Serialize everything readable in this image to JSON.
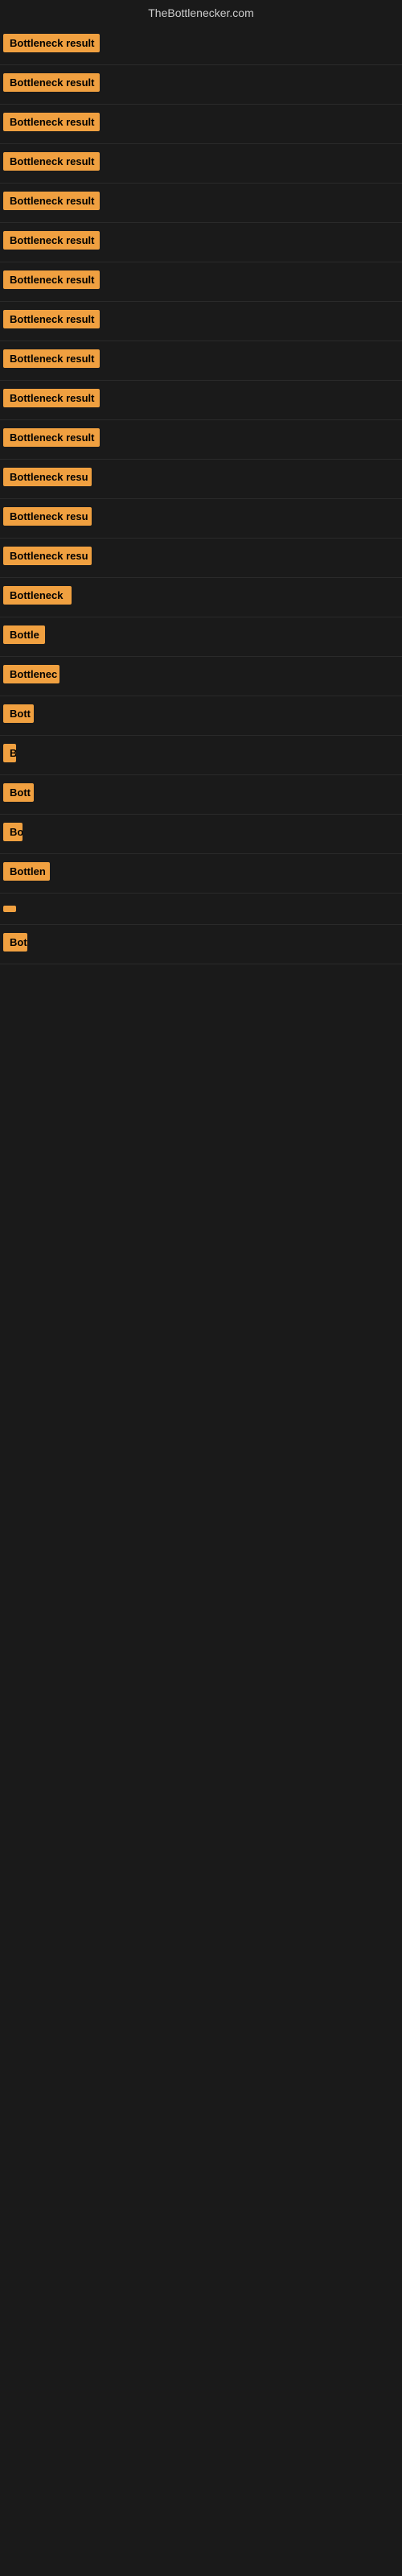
{
  "header": {
    "title": "TheBottlenecker.com"
  },
  "rows": [
    {
      "label": "Bottleneck result",
      "width": 120
    },
    {
      "label": "Bottleneck result",
      "width": 120
    },
    {
      "label": "Bottleneck result",
      "width": 120
    },
    {
      "label": "Bottleneck result",
      "width": 120
    },
    {
      "label": "Bottleneck result",
      "width": 120
    },
    {
      "label": "Bottleneck result",
      "width": 120
    },
    {
      "label": "Bottleneck result",
      "width": 120
    },
    {
      "label": "Bottleneck result",
      "width": 120
    },
    {
      "label": "Bottleneck result",
      "width": 120
    },
    {
      "label": "Bottleneck result",
      "width": 120
    },
    {
      "label": "Bottleneck result",
      "width": 120
    },
    {
      "label": "Bottleneck resu",
      "width": 110
    },
    {
      "label": "Bottleneck resu",
      "width": 110
    },
    {
      "label": "Bottleneck resu",
      "width": 110
    },
    {
      "label": "Bottleneck",
      "width": 85
    },
    {
      "label": "Bottle",
      "width": 52
    },
    {
      "label": "Bottlenec",
      "width": 70
    },
    {
      "label": "Bott",
      "width": 38
    },
    {
      "label": "B",
      "width": 14
    },
    {
      "label": "Bott",
      "width": 38
    },
    {
      "label": "Bo",
      "width": 24
    },
    {
      "label": "Bottlen",
      "width": 58
    },
    {
      "label": "",
      "width": 6
    },
    {
      "label": "Bot",
      "width": 30
    }
  ]
}
